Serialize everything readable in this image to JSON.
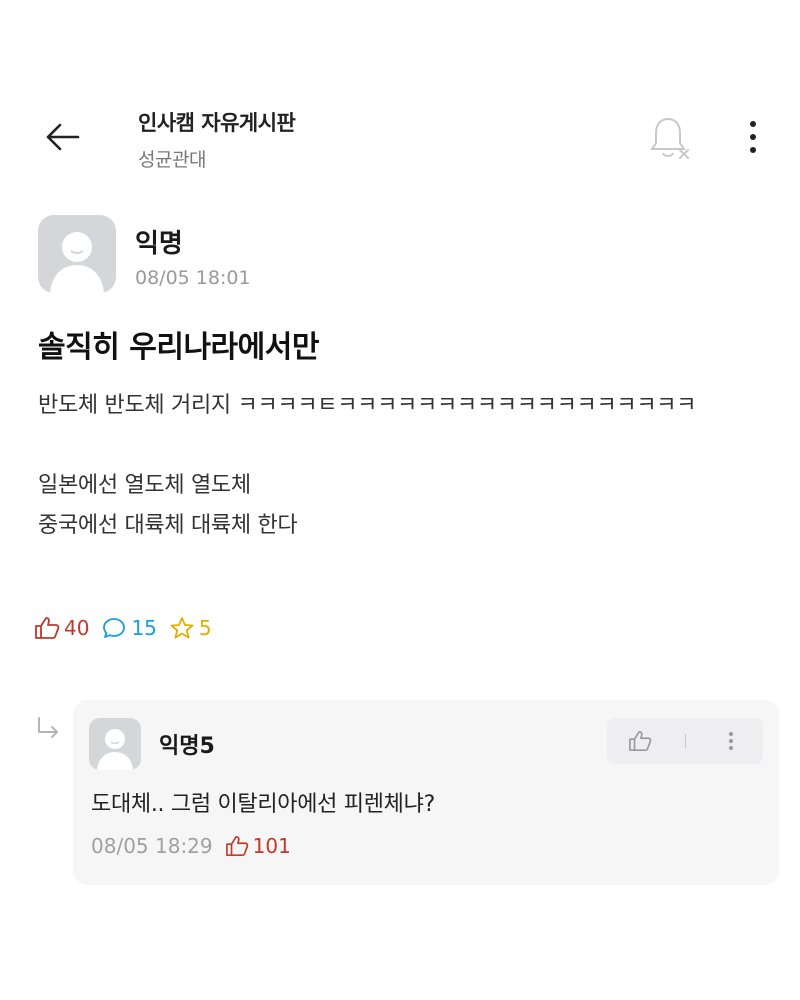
{
  "header": {
    "board_title": "인사캠 자유게시판",
    "board_subtitle": "성균관대",
    "icons": [
      "back-arrow-icon",
      "bell-off-icon",
      "more-vertical-icon"
    ]
  },
  "post": {
    "author": "익명",
    "timestamp": "08/05 18:01",
    "title": "솔직히 우리나라에서만",
    "body_lines": [
      "반도체 반도체 거리지 ㅋㅋㅋㅋㅌㅋㅋㅋㅋㅋㅋㅋㅋㅋㅋㅋㅋㅋㅋㅋㅋㅋㅋ",
      "일본에선 열도체 열도체\n중국에선 대륙체 대륙체 한다"
    ],
    "stats": {
      "likes": "40",
      "comments": "15",
      "scraps": "5"
    }
  },
  "comment": {
    "author": "익명5",
    "text": "도대체.. 그럼 이탈리아에선 피렌체냐?",
    "timestamp": "08/05 18:29",
    "likes": "101"
  },
  "colors": {
    "like": "#c0392b",
    "comment": "#1a9ed8",
    "scrap": "#e0b000",
    "muted": "#9a9a9a"
  }
}
